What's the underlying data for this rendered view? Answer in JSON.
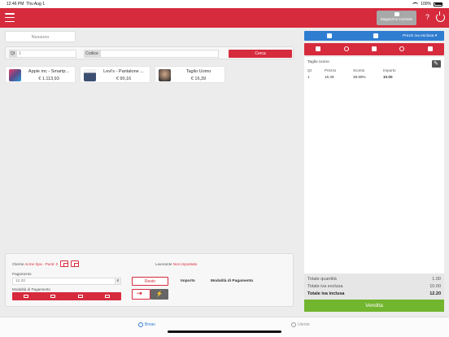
{
  "status": {
    "time": "12:46 PM",
    "date": "Thu Aug 1",
    "battery": "100%"
  },
  "header": {
    "warehouse_label": "Magazzino Centrale"
  },
  "customer": {
    "name": "Nessuno"
  },
  "search": {
    "qty_label": "Qt",
    "qty_value": "1",
    "code_label": "Codice",
    "code_value": "",
    "search_button": "Cerca"
  },
  "products": [
    {
      "name": "Apple mc - Smartp...",
      "price": "€ 1.113,93",
      "thumb_color": "#5b4c8a"
    },
    {
      "name": "Levi's - Pantalone ...",
      "price": "€ 90,16",
      "thumb_color": "#3c4f72"
    },
    {
      "name": "Taglio Uomo",
      "price": "€ 16,39",
      "thumb_color": "#6d6d6d"
    }
  ],
  "payment_panel": {
    "client_label": "Cliente",
    "client_value": "Acme Spa - Punti: 0",
    "worker_label": "Lavorante",
    "worker_value": "Non impostato",
    "payment_label": "Pagamento",
    "payment_value": "12.20",
    "currency": "€",
    "mode_label": "Modalità di Pagamento",
    "resto_button": "Resto",
    "col_importo": "Importo",
    "col_mode": "Modalità di Pagamento"
  },
  "right_panel": {
    "prices_mode": "Prezzi iva esclusa ▾",
    "cart_title": "Taglio Uomo",
    "columns": [
      "Qt",
      "Prezzo",
      "Sconto",
      "Importo"
    ],
    "rows": [
      {
        "qt": "1",
        "prezzo": "16.39",
        "sconto": "38.99%",
        "importo": "10.00"
      }
    ],
    "totals": [
      {
        "label": "Totale quantità",
        "value": "1.00"
      },
      {
        "label": "Totale iva esclusa",
        "value": "10.00"
      },
      {
        "label": "Totale iva inclusa",
        "value": "12.20"
      }
    ],
    "sell_button": "Vendita"
  },
  "tabs": {
    "active": "Bman",
    "inactive": "Utente"
  },
  "colors": {
    "brand_red": "#d62b3d",
    "accent_blue": "#2f7dd1",
    "sell_green": "#72b52e"
  }
}
